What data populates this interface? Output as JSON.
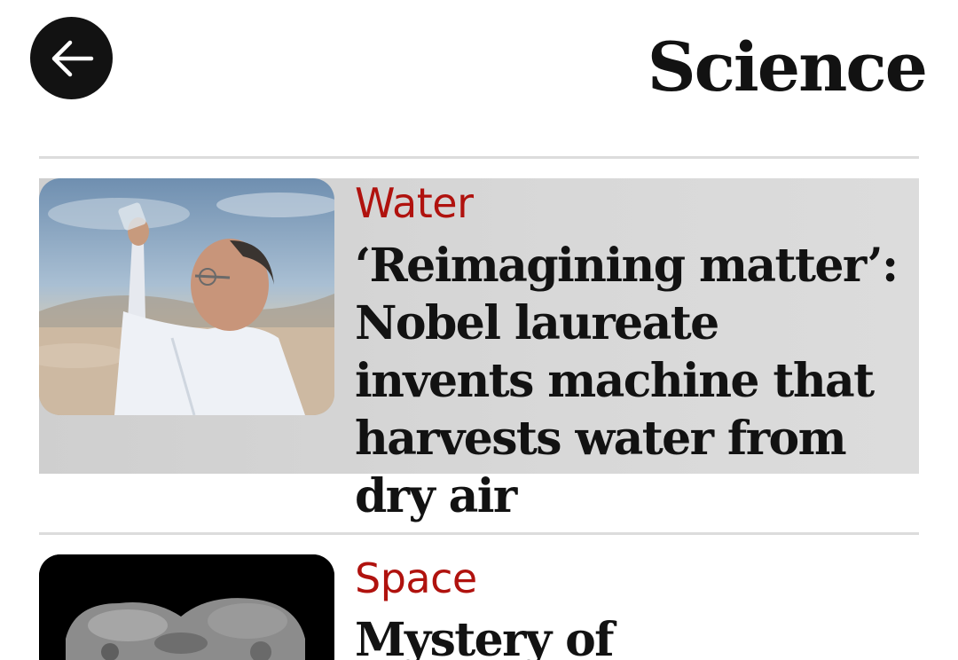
{
  "header": {
    "title": "Science",
    "back_icon": "arrow-left-icon"
  },
  "articles": [
    {
      "kicker": "Water",
      "headline": "‘Reimagining matter’: Nobel laureate invents machine that harvests water from dry air",
      "image_icon": "photo-man-holding-glass-in-desert"
    },
    {
      "kicker": "Space",
      "headline": "Mystery of",
      "image_icon": "photo-asteroid-grayscale"
    }
  ],
  "colors": {
    "kicker": "#b0120e",
    "text": "#121212",
    "divider": "#dcdcdc",
    "highlight": "#d4d4d4"
  }
}
